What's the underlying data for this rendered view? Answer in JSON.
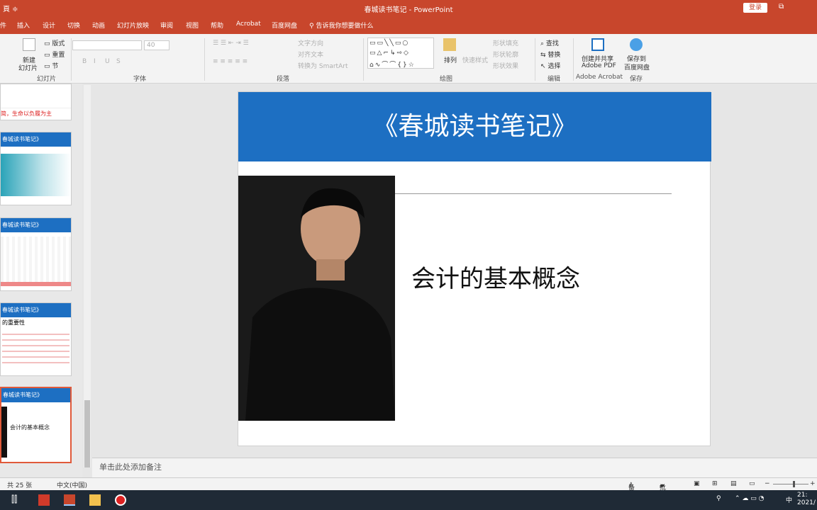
{
  "titlebar": {
    "qa_symbol": "頁 ≑",
    "title": "春城读书笔记 - PowerPoint",
    "login": "登录",
    "window_btn": "⧉"
  },
  "tabs": [
    "件",
    "插入",
    "设计",
    "切换",
    "动画",
    "幻灯片放映",
    "审阅",
    "视图",
    "帮助",
    "Acrobat",
    "百度网盘",
    "告诉我你想要做什么"
  ],
  "ribbon": {
    "slides": {
      "new_slide": "新建",
      "new_slide2": "幻灯片",
      "layout": "版式",
      "reset": "重置",
      "section": "节",
      "group": "幻灯片"
    },
    "font": {
      "size": "40",
      "group": "字体",
      "bold": "B",
      "italic": "I",
      "underline": "U",
      "strike": "S"
    },
    "paragraph": {
      "text_direction": "文字方向",
      "align_text": "对齐文本",
      "smartart": "转换为 SmartArt",
      "group": "段落"
    },
    "drawing": {
      "arrange": "排列",
      "quick_styles": "快速样式",
      "fill": "形状填充",
      "outline": "形状轮廓",
      "effects": "形状效果",
      "group": "绘图"
    },
    "editing": {
      "find": "查找",
      "replace": "替换",
      "select": "选择",
      "group": "编辑"
    },
    "acrobat": {
      "create1": "创建并共享",
      "create2": "Adobe PDF",
      "group": "Adobe Acrobat"
    },
    "save": {
      "save1": "保存到",
      "save2": "百度网盘",
      "group": "保存"
    }
  },
  "thumbnails": [
    {
      "header": "",
      "text": "简，生命以负履为主"
    },
    {
      "header": "春城读书笔记》",
      "text": ""
    },
    {
      "header": "春城读书笔记》",
      "text": ""
    },
    {
      "header": "春城读书笔记》",
      "text": "的重要性"
    },
    {
      "header": "春城读书笔记》",
      "text": "会计的基本概念"
    }
  ],
  "slide": {
    "title": "《春城读书笔记》",
    "subtitle": "会计的基本概念"
  },
  "notes": {
    "placeholder": "单击此处添加备注"
  },
  "status": {
    "slide_count": "共 25 张",
    "language": "中文(中国)",
    "notes": "备注",
    "comments": "批注"
  },
  "taskbar": {
    "time": "21:",
    "date": "2021/",
    "ime": "中"
  },
  "colors": {
    "ribbon_red": "#c8462c",
    "slide_blue": "#1d6fc2"
  }
}
